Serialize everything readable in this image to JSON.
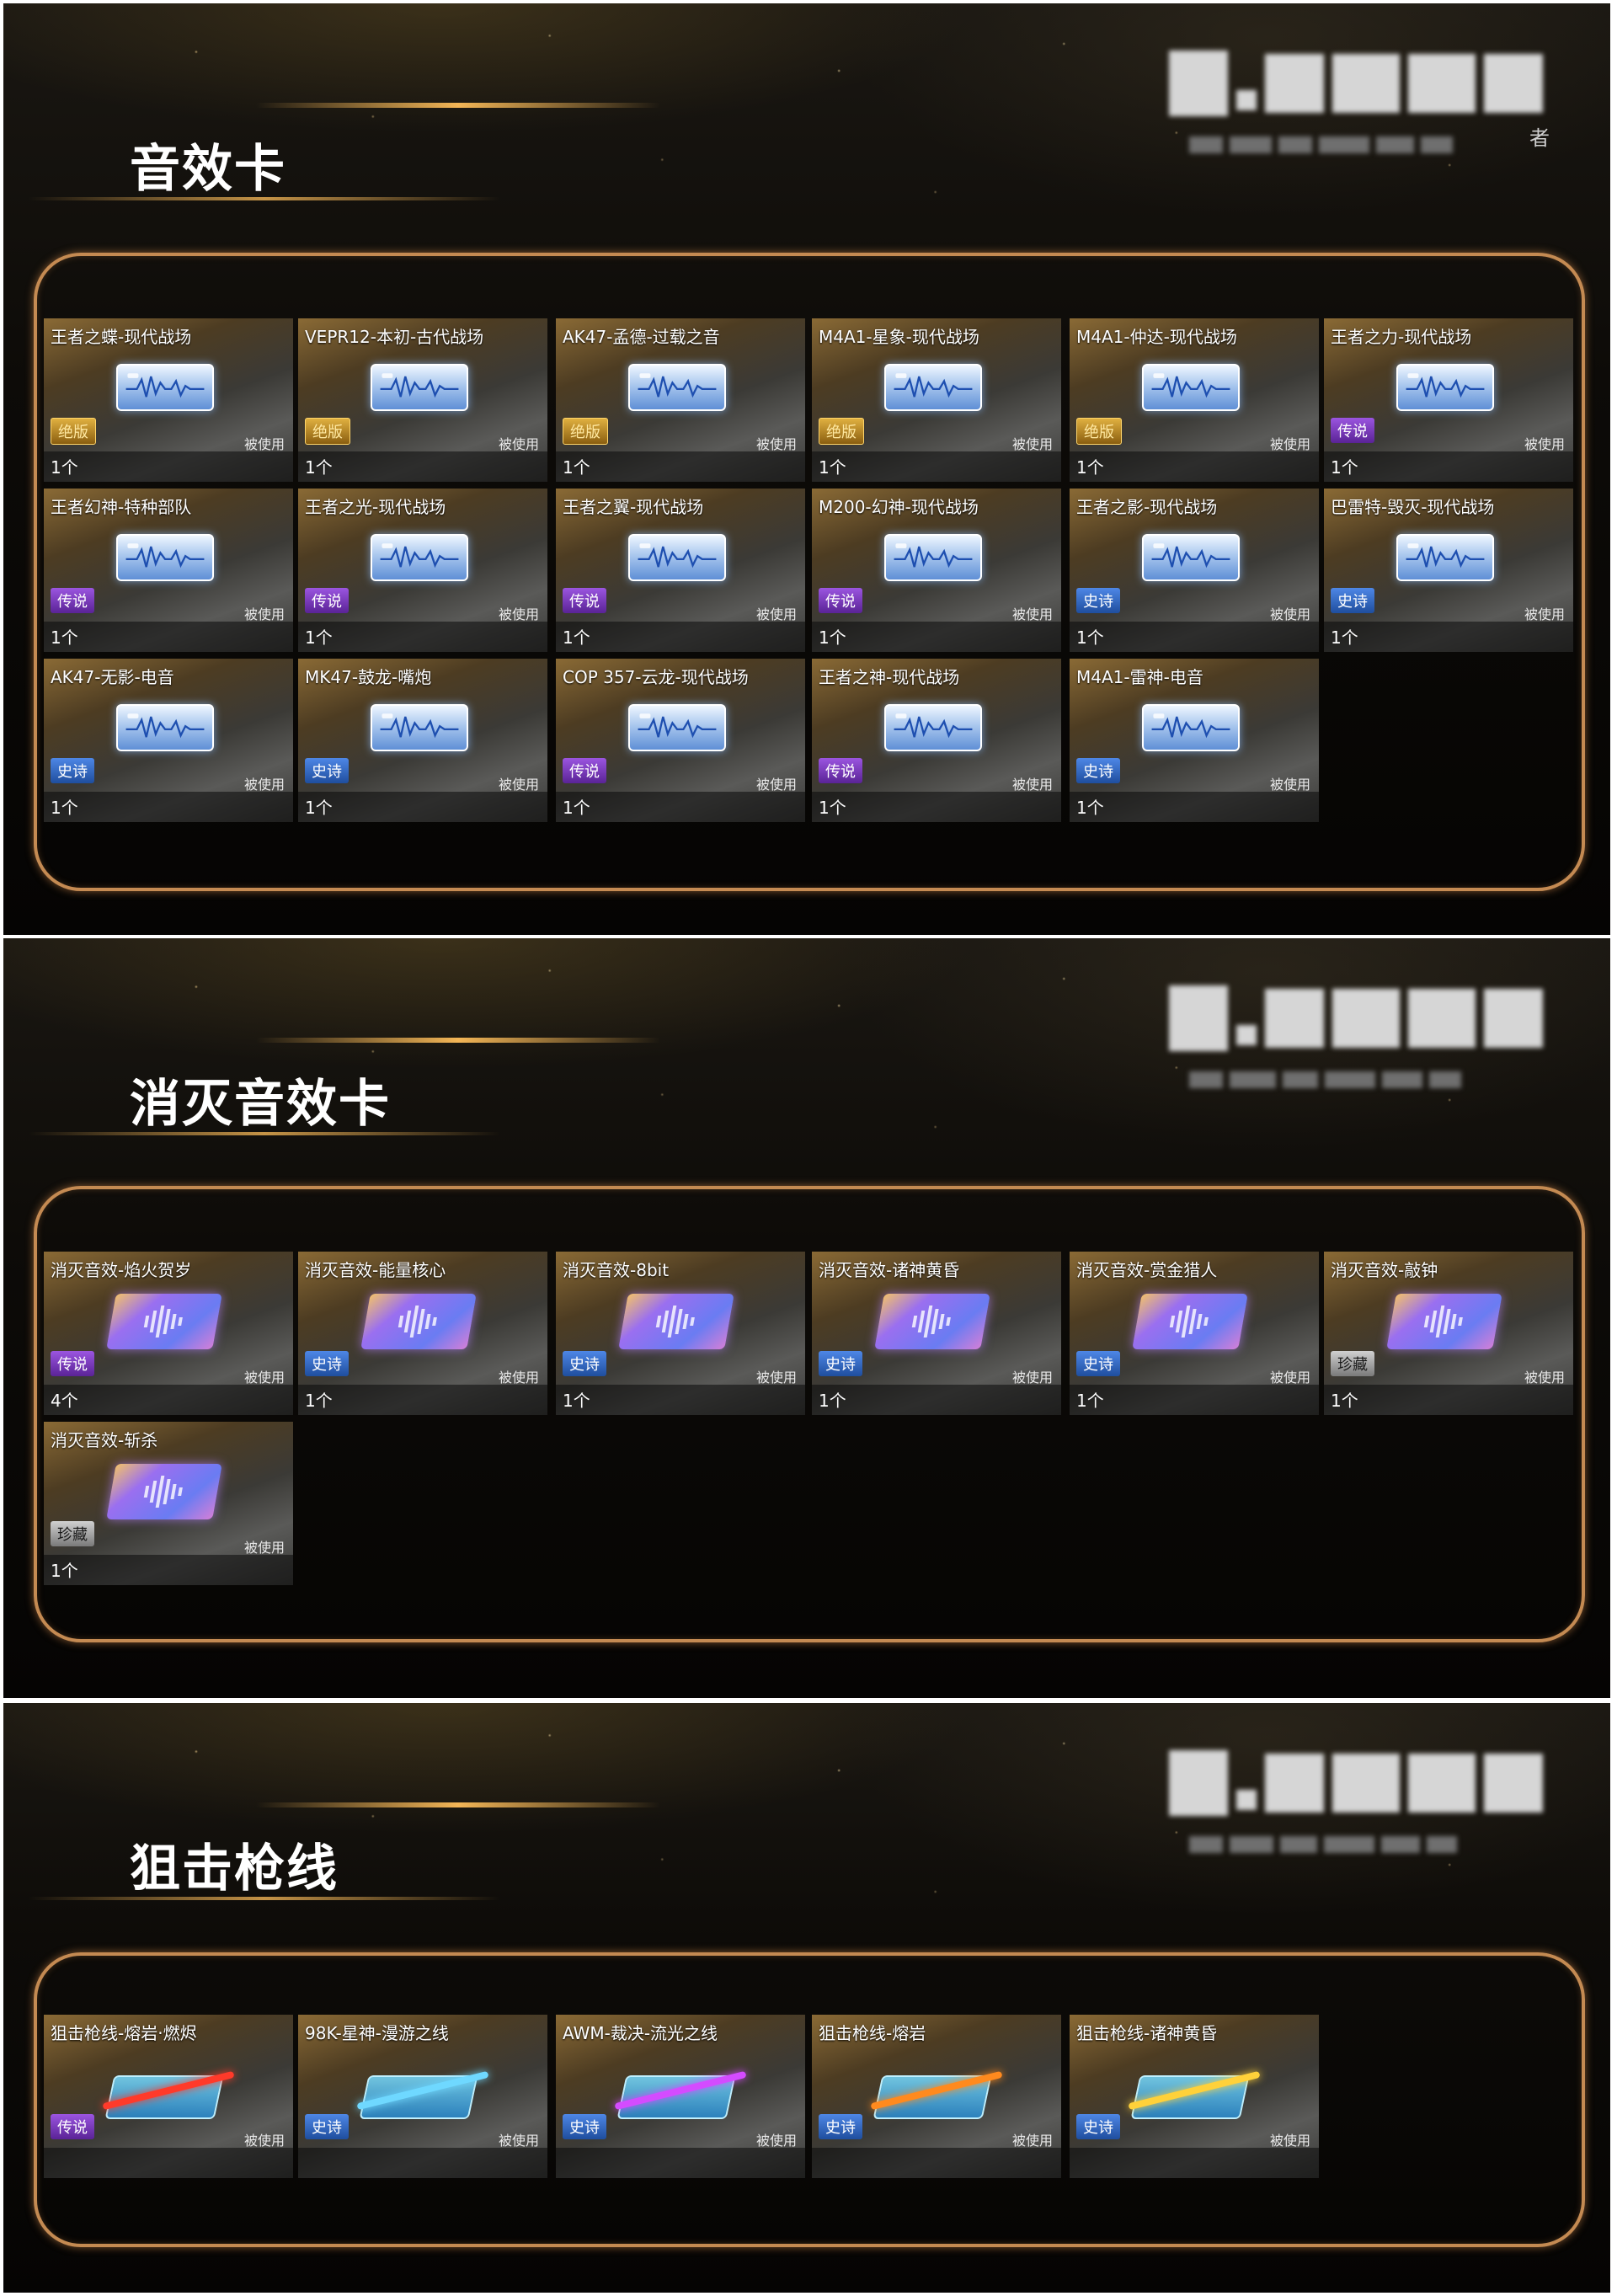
{
  "labels": {
    "status": "被使用",
    "watermark_char": "者"
  },
  "sections": [
    {
      "title": "音效卡",
      "icon": "sound-card-icon",
      "cards": [
        {
          "name": "王者之蝶-现代战场",
          "rarity": "绝版",
          "tier": "gold",
          "count": "1个"
        },
        {
          "name": "VEPR12-本初-古代战场",
          "rarity": "绝版",
          "tier": "gold",
          "count": "1个"
        },
        {
          "name": "AK47-孟德-过载之音",
          "rarity": "绝版",
          "tier": "gold",
          "count": "1个"
        },
        {
          "name": "M4A1-星象-现代战场",
          "rarity": "绝版",
          "tier": "gold",
          "count": "1个"
        },
        {
          "name": "M4A1-仲达-现代战场",
          "rarity": "绝版",
          "tier": "gold",
          "count": "1个"
        },
        {
          "name": "王者之力-现代战场",
          "rarity": "传说",
          "tier": "purple",
          "count": "1个"
        },
        {
          "name": "王者幻神-特种部队",
          "rarity": "传说",
          "tier": "purple",
          "count": "1个"
        },
        {
          "name": "王者之光-现代战场",
          "rarity": "传说",
          "tier": "purple",
          "count": "1个"
        },
        {
          "name": "王者之翼-现代战场",
          "rarity": "传说",
          "tier": "purple",
          "count": "1个"
        },
        {
          "name": "M200-幻神-现代战场",
          "rarity": "传说",
          "tier": "purple",
          "count": "1个"
        },
        {
          "name": "王者之影-现代战场",
          "rarity": "史诗",
          "tier": "blue",
          "count": "1个"
        },
        {
          "name": "巴雷特-毁灭-现代战场",
          "rarity": "史诗",
          "tier": "blue",
          "count": "1个"
        },
        {
          "name": "AK47-无影-电音",
          "rarity": "史诗",
          "tier": "blue",
          "count": "1个"
        },
        {
          "name": "MK47-鼓龙-嘴炮",
          "rarity": "史诗",
          "tier": "blue",
          "count": "1个"
        },
        {
          "name": "COP 357-云龙-现代战场",
          "rarity": "传说",
          "tier": "purple",
          "count": "1个"
        },
        {
          "name": "王者之神-现代战场",
          "rarity": "传说",
          "tier": "purple",
          "count": "1个"
        },
        {
          "name": "M4A1-雷神-电音",
          "rarity": "史诗",
          "tier": "blue",
          "count": "1个"
        }
      ]
    },
    {
      "title": "消灭音效卡",
      "icon": "kill-sound-card-icon",
      "cards": [
        {
          "name": "消灭音效-焰火贺岁",
          "rarity": "传说",
          "tier": "purple",
          "count": "4个"
        },
        {
          "name": "消灭音效-能量核心",
          "rarity": "史诗",
          "tier": "blue",
          "count": "1个"
        },
        {
          "name": "消灭音效-8bit",
          "rarity": "史诗",
          "tier": "blue",
          "count": "1个"
        },
        {
          "name": "消灭音效-诸神黄昏",
          "rarity": "史诗",
          "tier": "blue",
          "count": "1个"
        },
        {
          "name": "消灭音效-赏金猎人",
          "rarity": "史诗",
          "tier": "blue",
          "count": "1个"
        },
        {
          "name": "消灭音效-敲钟",
          "rarity": "珍藏",
          "tier": "gray",
          "count": "1个"
        },
        {
          "name": "消灭音效-斩杀",
          "rarity": "珍藏",
          "tier": "gray",
          "count": "1个"
        }
      ]
    },
    {
      "title": "狙击枪线",
      "icon": "sniper-line-icon",
      "cards": [
        {
          "name": "狙击枪线-熔岩·燃烬",
          "rarity": "传说",
          "tier": "purple",
          "count": "",
          "beam": "#ff3a2a"
        },
        {
          "name": "98K-星神-漫游之线",
          "rarity": "史诗",
          "tier": "blue",
          "count": "",
          "beam": "#6fd8ff"
        },
        {
          "name": "AWM-裁决-流光之线",
          "rarity": "史诗",
          "tier": "blue",
          "count": "",
          "beam": "#d44bff"
        },
        {
          "name": "狙击枪线-熔岩",
          "rarity": "史诗",
          "tier": "blue",
          "count": "",
          "beam": "#ff8a1e"
        },
        {
          "name": "狙击枪线-诸神黄昏",
          "rarity": "史诗",
          "tier": "blue",
          "count": "",
          "beam": "#ffd13a"
        }
      ]
    }
  ]
}
